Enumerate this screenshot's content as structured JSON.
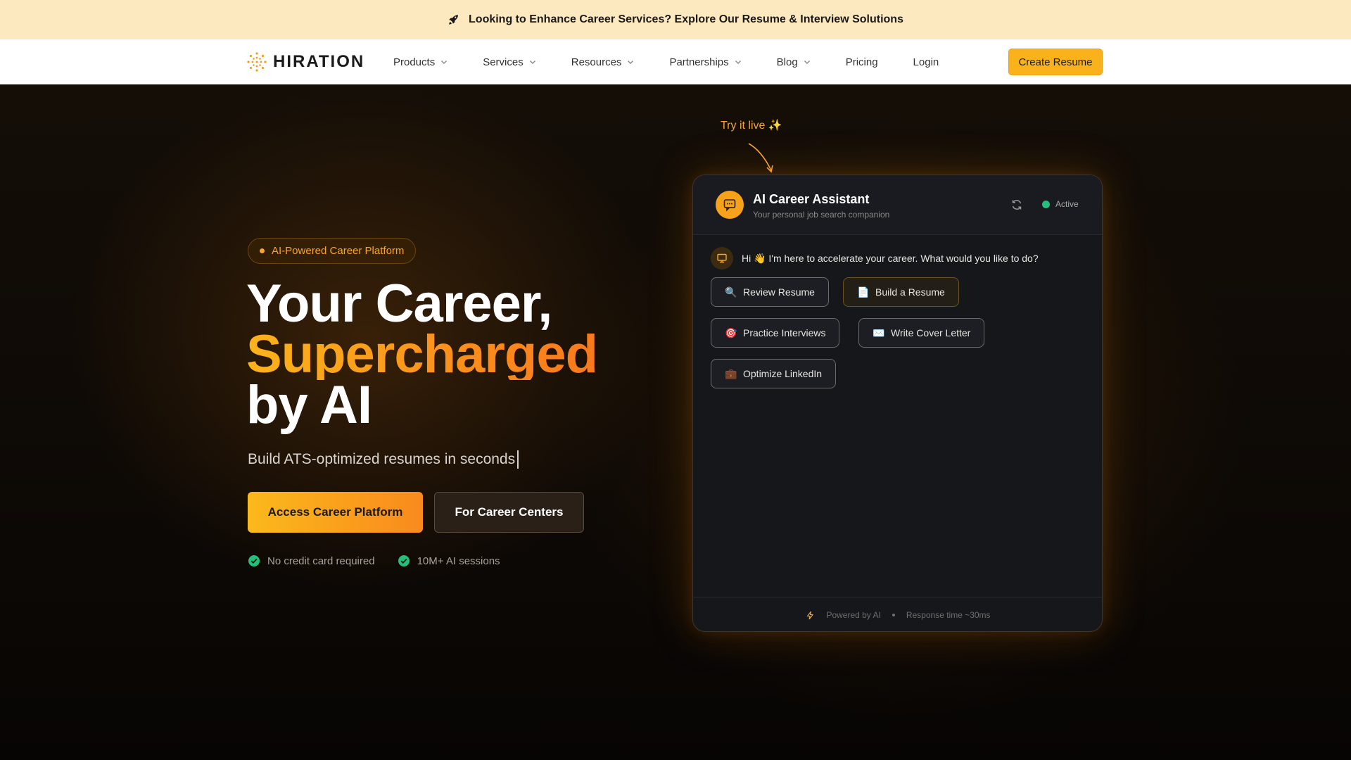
{
  "announcement": {
    "text": "Looking to Enhance Career Services? Explore Our Resume & Interview Solutions",
    "icon": "rocket-icon"
  },
  "nav": {
    "logo_text": "HIRATION",
    "items": [
      {
        "label": "Products",
        "dropdown": true
      },
      {
        "label": "Services",
        "dropdown": true
      },
      {
        "label": "Resources",
        "dropdown": true
      },
      {
        "label": "Partnerships",
        "dropdown": true
      },
      {
        "label": "Blog",
        "dropdown": true
      },
      {
        "label": "Pricing",
        "dropdown": false
      },
      {
        "label": "Login",
        "dropdown": false
      }
    ],
    "cta_label": "Create Resume"
  },
  "hero": {
    "badge": "AI-Powered Career Platform",
    "title_line1": "Your Career,",
    "title_line2": "Supercharged",
    "title_line3": "by AI",
    "subtitle": "Build ATS-optimized resumes in seconds",
    "primary_button": "Access Career Platform",
    "secondary_button": "For Career Centers",
    "checks": [
      "No credit card required",
      "10M+ AI sessions"
    ]
  },
  "chat": {
    "try_label": "Try it live ✨",
    "title": "AI Career Assistant",
    "subtitle": "Your personal job search companion",
    "status": "Active",
    "greeting": "Hi 👋 I'm here to accelerate your career. What would you like to do?",
    "options": [
      {
        "label": "Review Resume",
        "icon": "🔍"
      },
      {
        "label": "Build a Resume",
        "icon": "📄"
      },
      {
        "label": "Practice Interviews",
        "icon": "🎯"
      },
      {
        "label": "Write Cover Letter",
        "icon": "✉️"
      },
      {
        "label": "Optimize LinkedIn",
        "icon": "💼"
      }
    ],
    "footer_powered": "Powered by AI",
    "footer_response": "Response time ~30ms"
  },
  "colors": {
    "accent": "#f9b21b",
    "accent_orange": "#f9781d",
    "announcement_bg": "#fde9bf",
    "active_green": "#22c07a"
  }
}
